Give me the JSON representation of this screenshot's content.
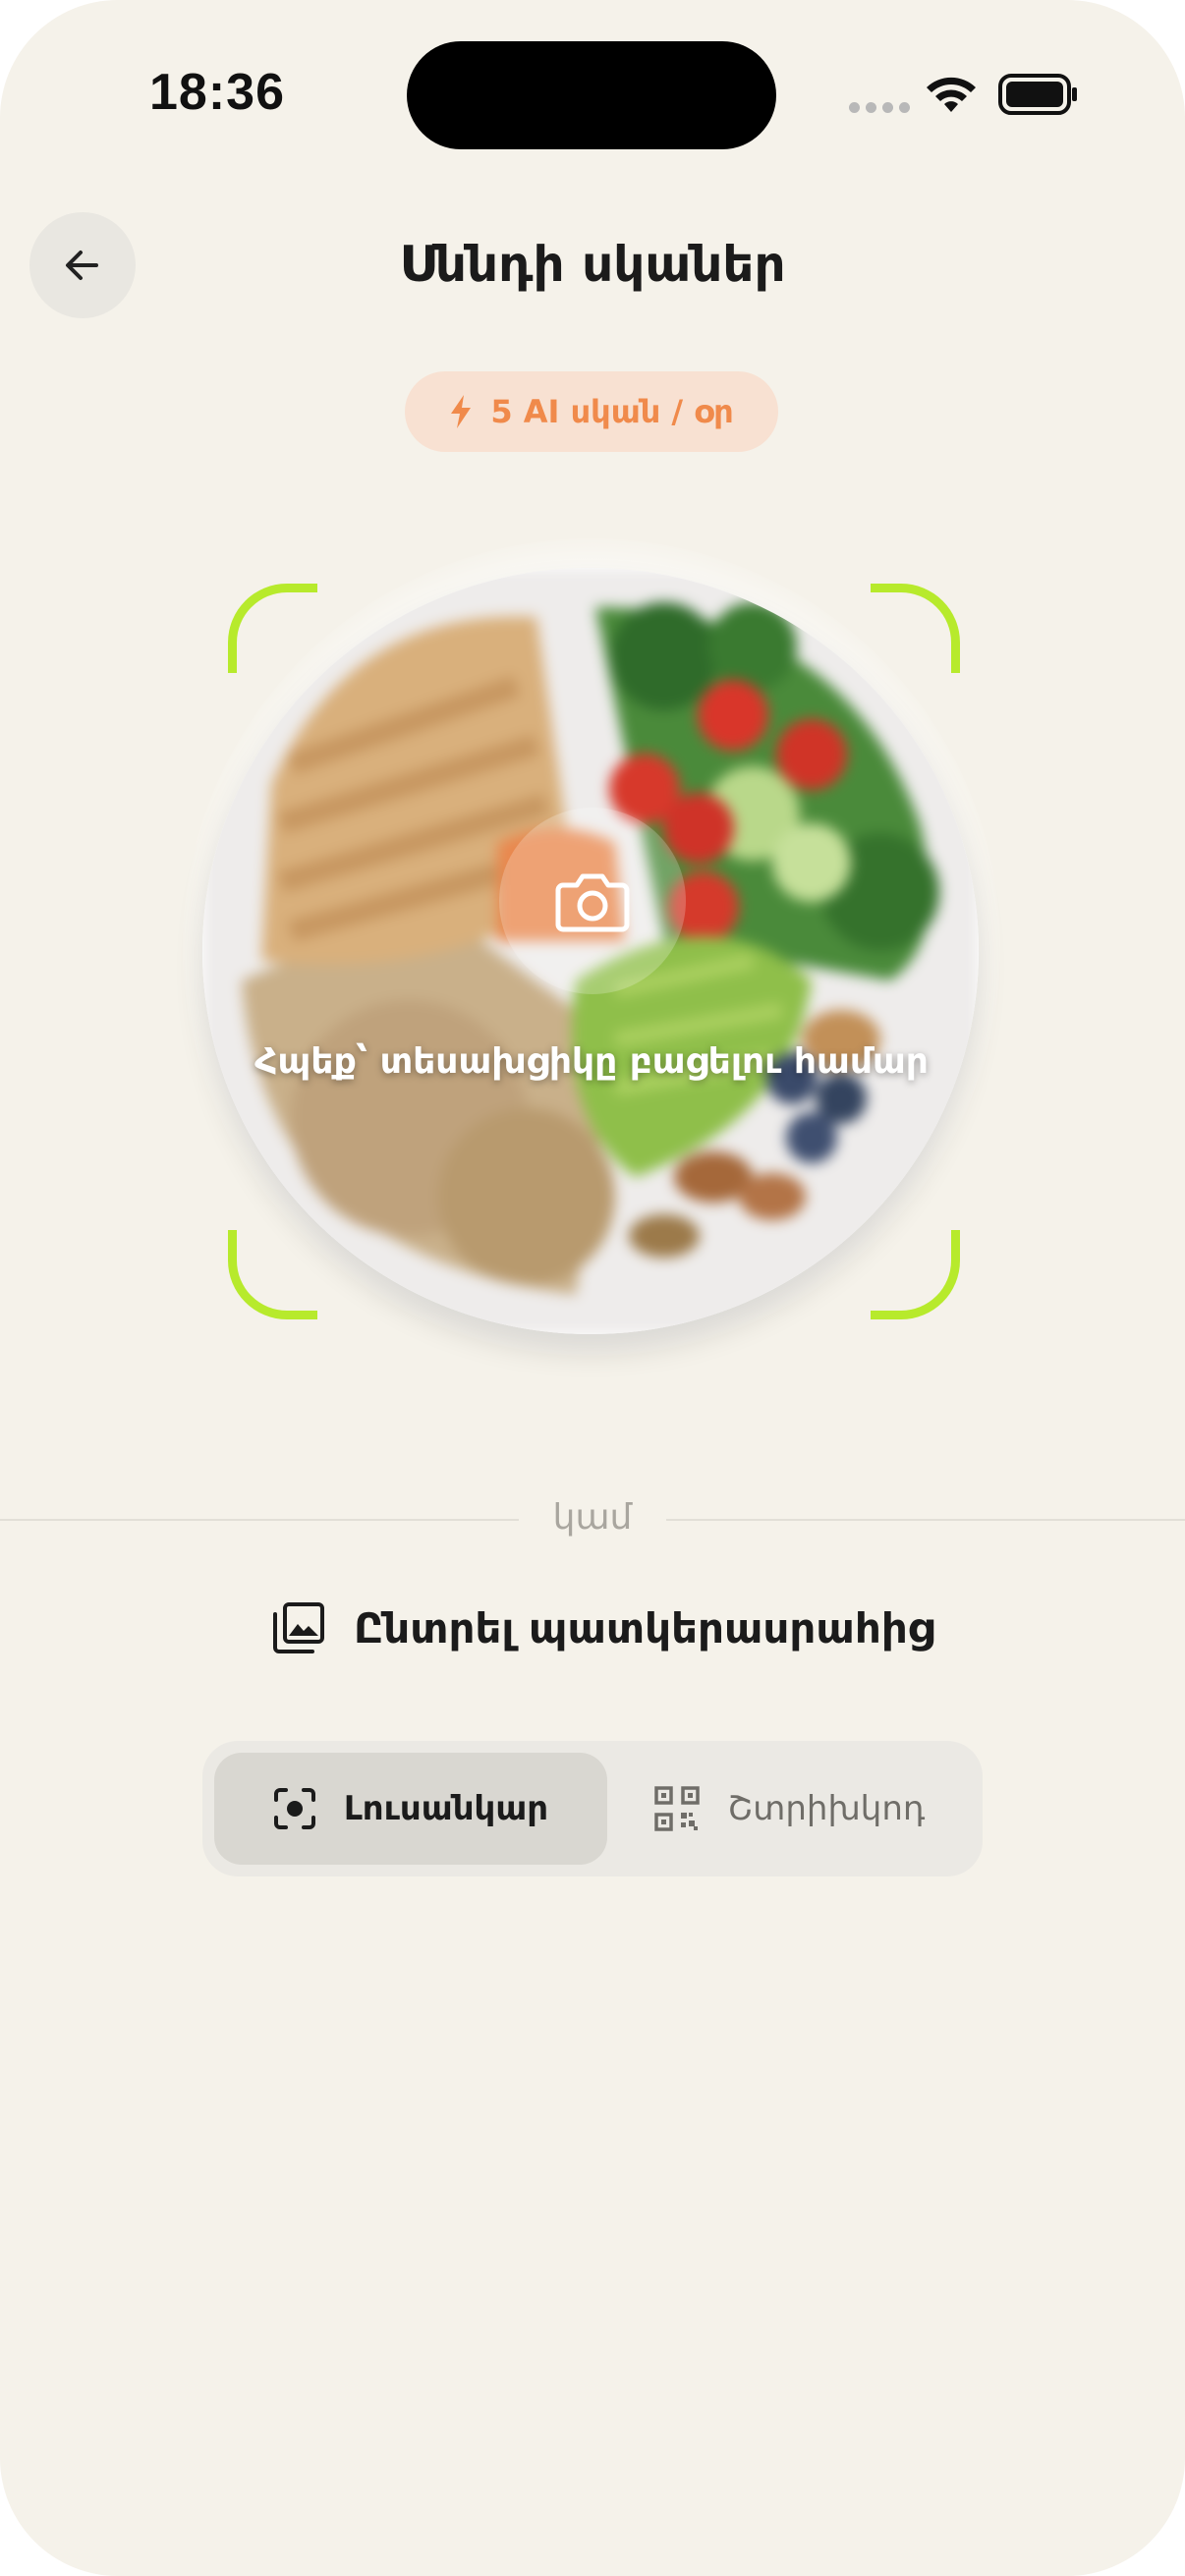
{
  "status_bar": {
    "time": "18:36"
  },
  "header": {
    "back_icon": "arrow-left-icon",
    "title": "Սննդի սկաներ"
  },
  "badge": {
    "icon": "lightning-icon",
    "label": "5 AI սկան / օր",
    "color": "#f08a4b"
  },
  "scanner": {
    "frame_color": "#b7ea2c",
    "camera_icon": "camera-icon",
    "hint": "Հպեք՝ տեսախցիկը բացելու համար"
  },
  "divider": {
    "label": "կամ"
  },
  "gallery": {
    "icon": "gallery-icon",
    "label": "Ընտրել պատկերասրահից"
  },
  "mode_switch": {
    "options": [
      {
        "label": "Լուսանկար",
        "icon": "focus-camera-icon",
        "selected": true
      },
      {
        "label": "Շտրիխկոդ",
        "icon": "qr-code-icon",
        "selected": false
      }
    ]
  }
}
